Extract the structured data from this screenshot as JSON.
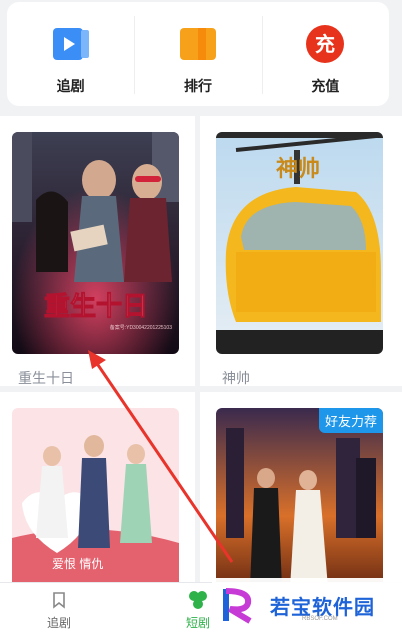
{
  "top_nav": [
    {
      "label": "追剧",
      "icon": "play-icon",
      "color": "#3a8ef6"
    },
    {
      "label": "排行",
      "icon": "ranking-icon",
      "color": "#f7a11a"
    },
    {
      "label": "充值",
      "icon": "recharge-icon",
      "color": "#e8331c",
      "glyph": "充"
    }
  ],
  "dramas": [
    {
      "title": "重生十日",
      "poster_text": "重生十日",
      "reg_no": "备案号:YD30042201225103"
    },
    {
      "title": "神帅",
      "poster_text": "神帅"
    },
    {
      "title": "",
      "poster_text": "爱恨 情仇"
    },
    {
      "title": "",
      "badge": "好友力荐"
    }
  ],
  "tabbar": [
    {
      "label": "追剧",
      "icon": "bookmark-icon",
      "active": false
    },
    {
      "label": "短剧",
      "icon": "drama-icon",
      "active": true
    }
  ],
  "watermark": {
    "text": "若宝软件园",
    "sub": "RBSOF.COM"
  },
  "colors": {
    "accent": "#2fb24a",
    "annotation_arrow": "#e8342b"
  }
}
